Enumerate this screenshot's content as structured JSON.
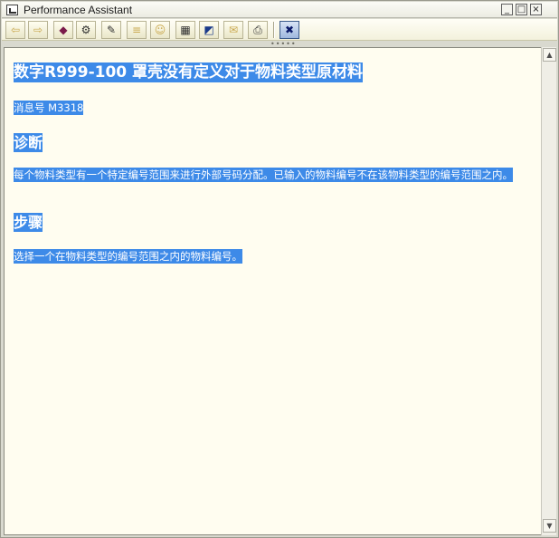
{
  "window": {
    "title": "Performance Assistant",
    "buttons": {
      "minimize": "_",
      "maximize": "□",
      "close": "×"
    }
  },
  "toolbar": {
    "buttons": [
      {
        "name": "back-icon",
        "glyph": "⇦",
        "enabled": false
      },
      {
        "name": "forward-icon",
        "glyph": "⇨",
        "enabled": false
      },
      {
        "name": "book-icon",
        "glyph": "◆",
        "enabled": true
      },
      {
        "name": "technical-info-icon",
        "glyph": "⚙",
        "enabled": true
      },
      {
        "name": "edit-icon",
        "glyph": "✎",
        "enabled": true
      },
      {
        "name": "note-icon",
        "glyph": "≡",
        "enabled": false
      },
      {
        "name": "user-icon",
        "glyph": "☺",
        "enabled": false
      },
      {
        "name": "table-icon",
        "glyph": "▦",
        "enabled": true
      },
      {
        "name": "display-icon",
        "glyph": "◩",
        "enabled": true
      },
      {
        "name": "message-icon",
        "glyph": "✉",
        "enabled": false
      },
      {
        "name": "print-icon",
        "glyph": "⎙",
        "enabled": true
      },
      {
        "name": "close-doc-icon",
        "glyph": "✖",
        "enabled": true
      }
    ]
  },
  "document": {
    "title": "数字R999-100 罩壳没有定义对于物料类型原材料",
    "message_number": "消息号 M3318",
    "diagnosis_heading": "诊断",
    "diagnosis_text": "每个物料类型有一个特定编号范围来进行外部号码分配。已输入的物料编号不在该物料类型的编号范围之内。",
    "steps_heading": "步骤",
    "steps_text": "选择一个在物料类型的编号范围之内的物料编号。"
  },
  "scrollbar": {
    "up": "▲",
    "down": "▼"
  },
  "colors": {
    "selection": "#3d8ae8",
    "content_bg": "#fffdf0"
  }
}
